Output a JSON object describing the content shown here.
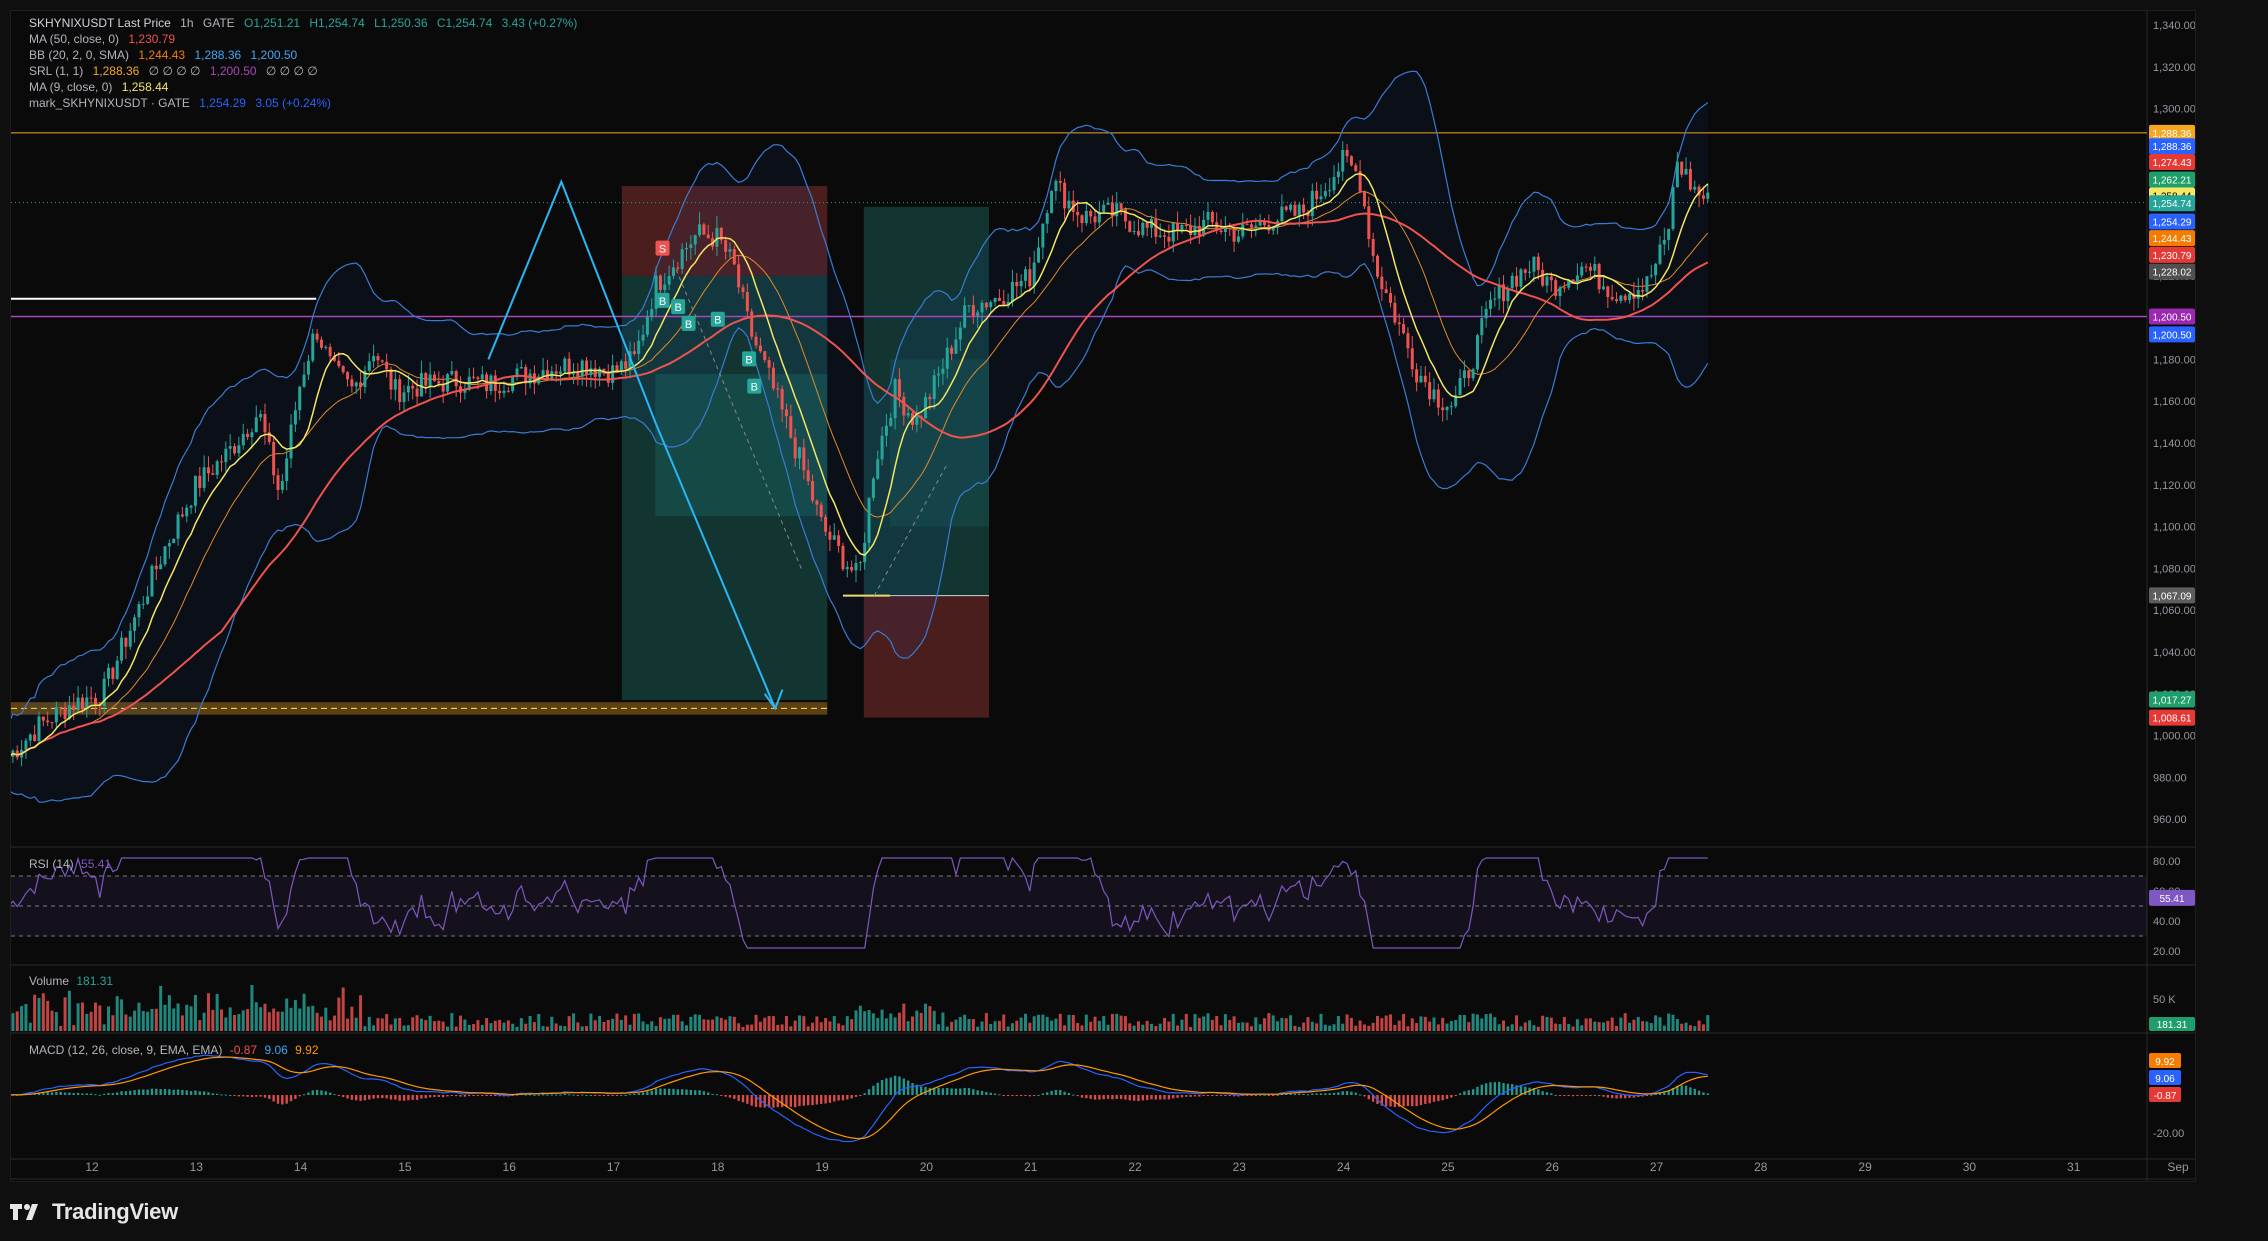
{
  "legend": {
    "main": {
      "symbol": "SKHYNIXUSDT Last Price",
      "interval": "1h",
      "exchange": "GATE",
      "o": "O1,251.21",
      "h": "H1,254.74",
      "l": "L1,250.36",
      "c": "C1,254.74",
      "chg": "3.43 (+0.27%)"
    },
    "ma50": {
      "label": "MA (50, close, 0)",
      "value": "1,230.79"
    },
    "bb": {
      "label": "BB (20, 2, 0, SMA)",
      "v1": "1,244.43",
      "v2": "1,288.36",
      "v3": "1,200.50"
    },
    "srl": {
      "label": "SRL (1, 1)",
      "v1": "1,288.36",
      "zeros1": "∅ ∅ ∅ ∅",
      "v2": "1,200.50",
      "zeros2": "∅ ∅ ∅ ∅"
    },
    "ma9": {
      "label": "MA (9, close, 0)",
      "value": "1,258.44"
    },
    "mark": {
      "label": "mark_SKHYNIXUSDT · GATE",
      "value": "1,254.29",
      "chg": "3.05 (+0.24%)"
    }
  },
  "rsi_legend": {
    "label": "RSI (14)",
    "value": "55.41"
  },
  "volume_legend": {
    "label": "Volume",
    "value": "181.31"
  },
  "macd_legend": {
    "label": "MACD (12, 26, close, 9, EMA, EMA)",
    "v1": "-0.87",
    "v2": "9.06",
    "v3": "9.92"
  },
  "footer": {
    "brand": "TradingView"
  },
  "colors": {
    "up": "#26a69a",
    "down": "#ef5350",
    "ma9": "#f5e663",
    "ma50": "#ef5350",
    "bb_basis": "#e08a2c",
    "bb_band": "#3a7bd5",
    "rsi": "#7e57c2",
    "macd": "#2962ff",
    "signal": "#ff9800"
  },
  "chart_data": {
    "type": "candlestick",
    "x_ticks": [
      "12",
      "13",
      "14",
      "15",
      "16",
      "17",
      "18",
      "19",
      "20",
      "21",
      "22",
      "23",
      "24",
      "25",
      "26",
      "27",
      "28",
      "29",
      "30",
      "31",
      "Sep"
    ],
    "y_ticks": [
      "1,340.00",
      "1,320.00",
      "1,300.00",
      "1,280.00",
      "1,260.00",
      "1,240.00",
      "1,220.00",
      "1,200.00",
      "1,180.00",
      "1,160.00",
      "1,140.00",
      "1,120.00",
      "1,100.00",
      "1,080.00",
      "1,060.00",
      "1,040.00",
      "1,020.00",
      "1,000.00",
      "980.00",
      "960.00"
    ],
    "ylim": [
      950,
      1345
    ],
    "price_path": [
      [
        11.2,
        990
      ],
      [
        11.5,
        1005
      ],
      [
        11.8,
        1015
      ],
      [
        12.1,
        1020
      ],
      [
        12.4,
        1055
      ],
      [
        12.7,
        1090
      ],
      [
        13.0,
        1120
      ],
      [
        13.3,
        1135
      ],
      [
        13.6,
        1155
      ],
      [
        13.8,
        1115
      ],
      [
        14.0,
        1170
      ],
      [
        14.15,
        1195
      ],
      [
        14.3,
        1175
      ],
      [
        14.5,
        1165
      ],
      [
        14.7,
        1185
      ],
      [
        14.9,
        1165
      ],
      [
        15.2,
        1168
      ],
      [
        15.5,
        1170
      ],
      [
        15.8,
        1168
      ],
      [
        16.1,
        1172
      ],
      [
        16.4,
        1176
      ],
      [
        16.7,
        1178
      ],
      [
        17.0,
        1174
      ],
      [
        17.2,
        1180
      ],
      [
        17.4,
        1215
      ],
      [
        17.6,
        1228
      ],
      [
        17.8,
        1240
      ],
      [
        18.0,
        1238
      ],
      [
        18.15,
        1225
      ],
      [
        18.3,
        1195
      ],
      [
        18.5,
        1170
      ],
      [
        18.8,
        1130
      ],
      [
        19.0,
        1100
      ],
      [
        19.2,
        1085
      ],
      [
        19.35,
        1075
      ],
      [
        19.5,
        1130
      ],
      [
        19.7,
        1165
      ],
      [
        19.9,
        1150
      ],
      [
        20.1,
        1170
      ],
      [
        20.4,
        1205
      ],
      [
        20.7,
        1210
      ],
      [
        21.0,
        1220
      ],
      [
        21.2,
        1265
      ],
      [
        21.5,
        1248
      ],
      [
        21.8,
        1250
      ],
      [
        22.1,
        1242
      ],
      [
        22.4,
        1240
      ],
      [
        22.7,
        1245
      ],
      [
        23.0,
        1240
      ],
      [
        23.3,
        1247
      ],
      [
        23.6,
        1250
      ],
      [
        23.8,
        1262
      ],
      [
        24.0,
        1275
      ],
      [
        24.15,
        1268
      ],
      [
        24.3,
        1225
      ],
      [
        24.5,
        1200
      ],
      [
        24.7,
        1175
      ],
      [
        24.9,
        1162
      ],
      [
        25.05,
        1158
      ],
      [
        25.2,
        1175
      ],
      [
        25.4,
        1205
      ],
      [
        25.6,
        1218
      ],
      [
        25.8,
        1225
      ],
      [
        26.0,
        1215
      ],
      [
        26.3,
        1225
      ],
      [
        26.6,
        1212
      ],
      [
        26.9,
        1215
      ],
      [
        27.1,
        1238
      ],
      [
        27.2,
        1275
      ],
      [
        27.35,
        1262
      ],
      [
        27.5,
        1255
      ]
    ],
    "annotations": {
      "h_lines": [
        {
          "y": 1288.36,
          "label": "1,288.36"
        },
        {
          "y": 1200.5,
          "label": "1,200.50"
        }
      ],
      "buy_labels": [
        "B",
        "B",
        "B",
        "B",
        "B",
        "B"
      ],
      "sell_labels": [
        "S"
      ]
    },
    "price_badges": [
      {
        "v": 1288.36,
        "label": "1,288.36",
        "bg": "#f5a623"
      },
      {
        "v": 1282,
        "label": "1,288.36",
        "bg": "#2962ff"
      },
      {
        "v": 1274.43,
        "label": "1,274.43",
        "bg": "#e53935"
      },
      {
        "v": 1266,
        "label": "1,262.21",
        "bg": "#1e9e6a"
      },
      {
        "v": 1258.44,
        "label": "1,258.44",
        "bg": "#f5e663"
      },
      {
        "v": 1254.74,
        "label": "1,254.74",
        "bg": "#26a69a"
      },
      {
        "v": 1246,
        "label": "1,254.29",
        "bg": "#2962ff"
      },
      {
        "v": 1238,
        "label": "1,244.43",
        "bg": "#f57c00"
      },
      {
        "v": 1230,
        "label": "1,230.79",
        "bg": "#e53935"
      },
      {
        "v": 1222,
        "label": "1,228.02",
        "bg": "#505050"
      },
      {
        "v": 1200.5,
        "label": "1,200.50",
        "bg": "#9c27b0"
      },
      {
        "v": 1192,
        "label": "1,200.50",
        "bg": "#2962ff"
      },
      {
        "v": 1067.09,
        "label": "1,067.09",
        "bg": "#5d5d5d"
      },
      {
        "v": 1017.27,
        "label": "1,017.27",
        "bg": "#1e9e6a"
      },
      {
        "v": 1008.61,
        "label": "1,008.61",
        "bg": "#e53935"
      }
    ],
    "rsi": {
      "ticks": [
        "80.00",
        "60.00",
        "40.00",
        "20.00"
      ],
      "last": "55.41",
      "upper": 70,
      "lower": 30,
      "mid": 50
    },
    "volume": {
      "ticks": [
        "50 K"
      ],
      "last": "181.31"
    },
    "macd": {
      "ticks": [
        "-20.00"
      ],
      "badges": [
        "9.92",
        "9.06",
        "-0.87"
      ]
    }
  }
}
